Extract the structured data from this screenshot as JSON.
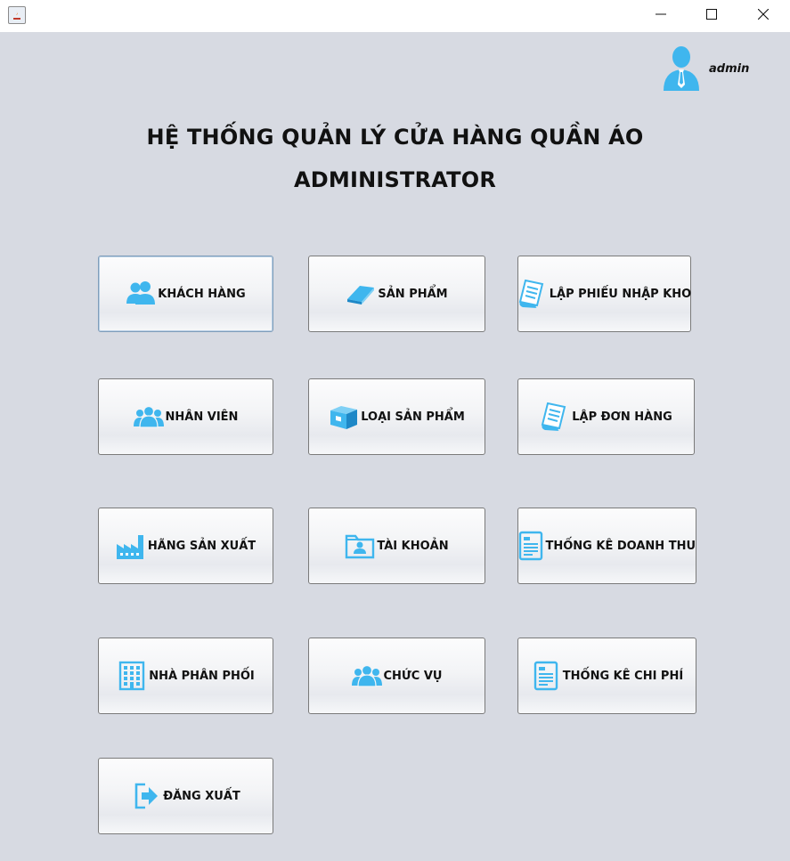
{
  "window": {
    "controls": [
      "minimize-icon",
      "maximize-icon",
      "close-icon"
    ]
  },
  "user": {
    "name": "admin"
  },
  "header": {
    "title": "HỆ THỐNG QUẢN LÝ CỬA HÀNG QUẦN ÁO",
    "subtitle": "ADMINISTRATOR"
  },
  "menu": {
    "khach_hang": "KHÁCH HÀNG",
    "san_pham": "SẢN PHẨM",
    "lap_phieu_nhap_kho": "LẬP PHIẾU NHẬP KHO",
    "nhan_vien": "NHÂN VIÊN",
    "loai_san_pham": "LOẠI SẢN PHẨM",
    "lap_don_hang": "LẬP ĐƠN HÀNG",
    "hang_san_xuat": "HÃNG SẢN XUẤT",
    "tai_khoan": "TÀI KHOẢN",
    "thong_ke_doanh_thu": "THỐNG KÊ DOANH THU",
    "nha_phan_phoi": "NHÀ PHÂN PHỐI",
    "chuc_vu": "CHỨC VỤ",
    "thong_ke_chi_phi": "THỐNG KÊ CHI PHÍ",
    "dang_xuat": "ĐĂNG XUẤT"
  },
  "colors": {
    "accent": "#3fb6ee",
    "background": "#d7dae2"
  }
}
